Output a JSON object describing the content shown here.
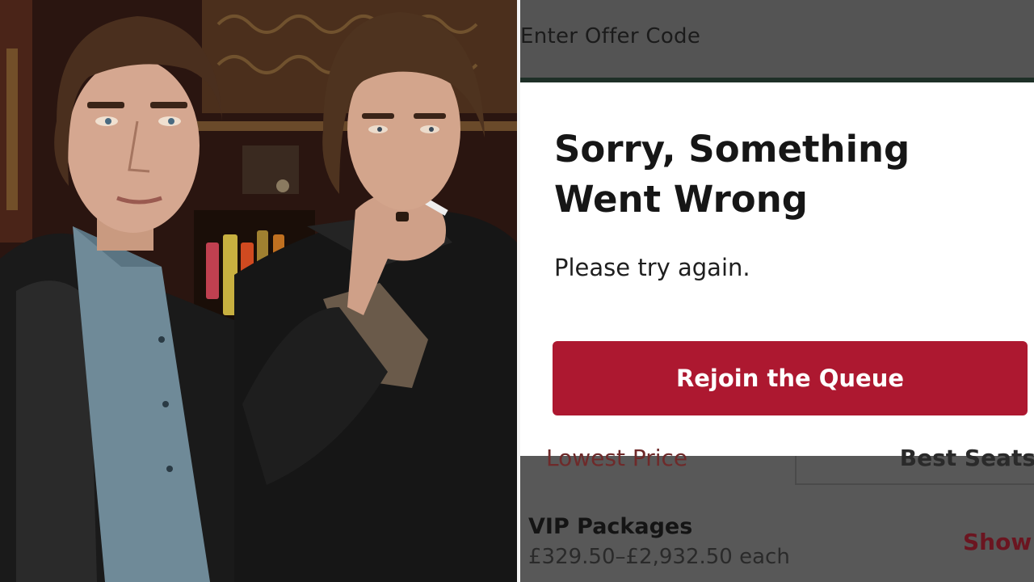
{
  "photo": {
    "description": ""
  },
  "app": {
    "offer_code_placeholder": "Enter Offer Code",
    "modal": {
      "title": "Sorry, Something Went Wrong",
      "message": "Please try again.",
      "button_label": "Rejoin the Queue"
    },
    "sort": {
      "left_label": "Lowest Price",
      "right_label": "Best Seats"
    },
    "listing": {
      "title": "VIP Packages",
      "price": "£329.50–£2,932.50 each",
      "action": "Show"
    }
  },
  "colors": {
    "button": "#ad1830",
    "overlay": "#555555",
    "modal_bg": "#ffffff"
  }
}
